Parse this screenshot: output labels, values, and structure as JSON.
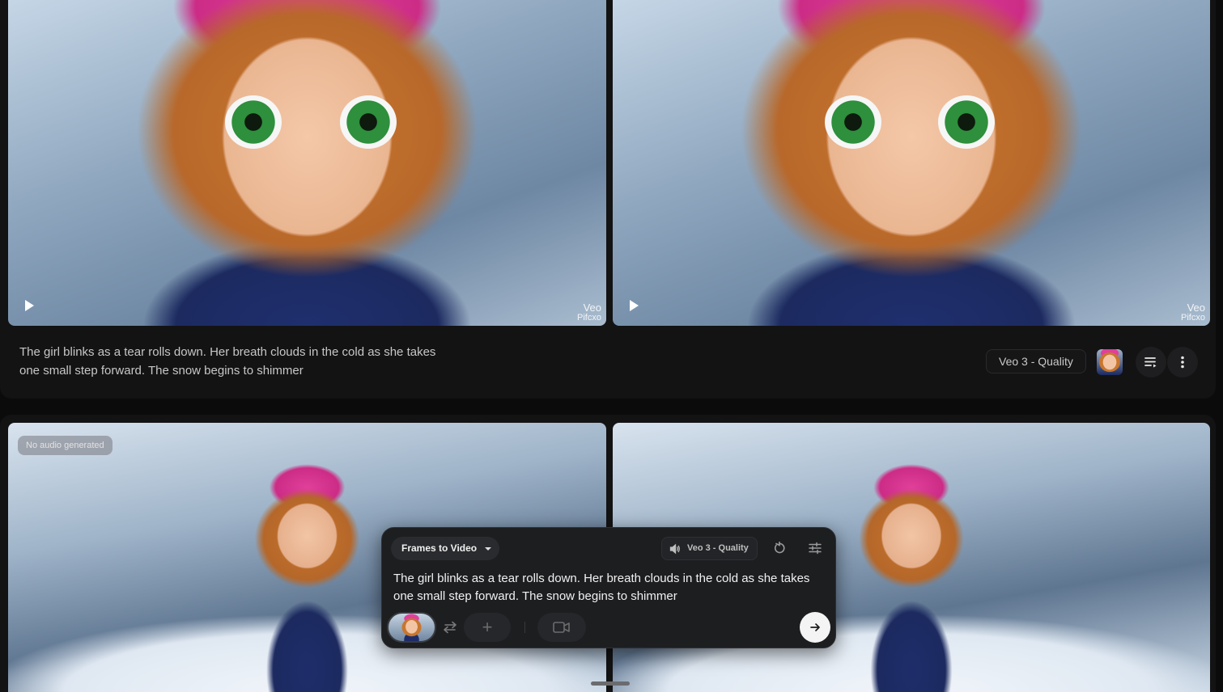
{
  "top_result": {
    "prompt": "The girl blinks as a tear rolls down. Her breath clouds in the cold as she takes one small step forward. The snow begins to shimmer",
    "model_label": "Veo 3 - Quality",
    "watermark_line1": "Veo",
    "watermark_line2": "Pifcxo"
  },
  "bottom_result": {
    "no_audio_badge": "No audio generated"
  },
  "composer": {
    "mode_label": "Frames to Video",
    "model_label": "Veo 3 - Quality",
    "prompt_text": "The girl blinks as a tear rolls down. Her breath clouds in the cold as she takes one small step forward. The snow begins to shimmer",
    "add_symbol": "+"
  },
  "icons": {
    "play": "play-icon",
    "list": "list-icon",
    "more": "more-vertical-icon",
    "speaker": "speaker-icon",
    "reset": "reset-icon",
    "tune": "tune-icon",
    "swap": "swap-icon",
    "extend": "video-extend-icon",
    "send": "arrow-right-icon"
  },
  "colors": {
    "background": "#0b0b0c",
    "card": "#131314",
    "composer": "#1d1e20",
    "send_button": "#f4f4f4"
  }
}
